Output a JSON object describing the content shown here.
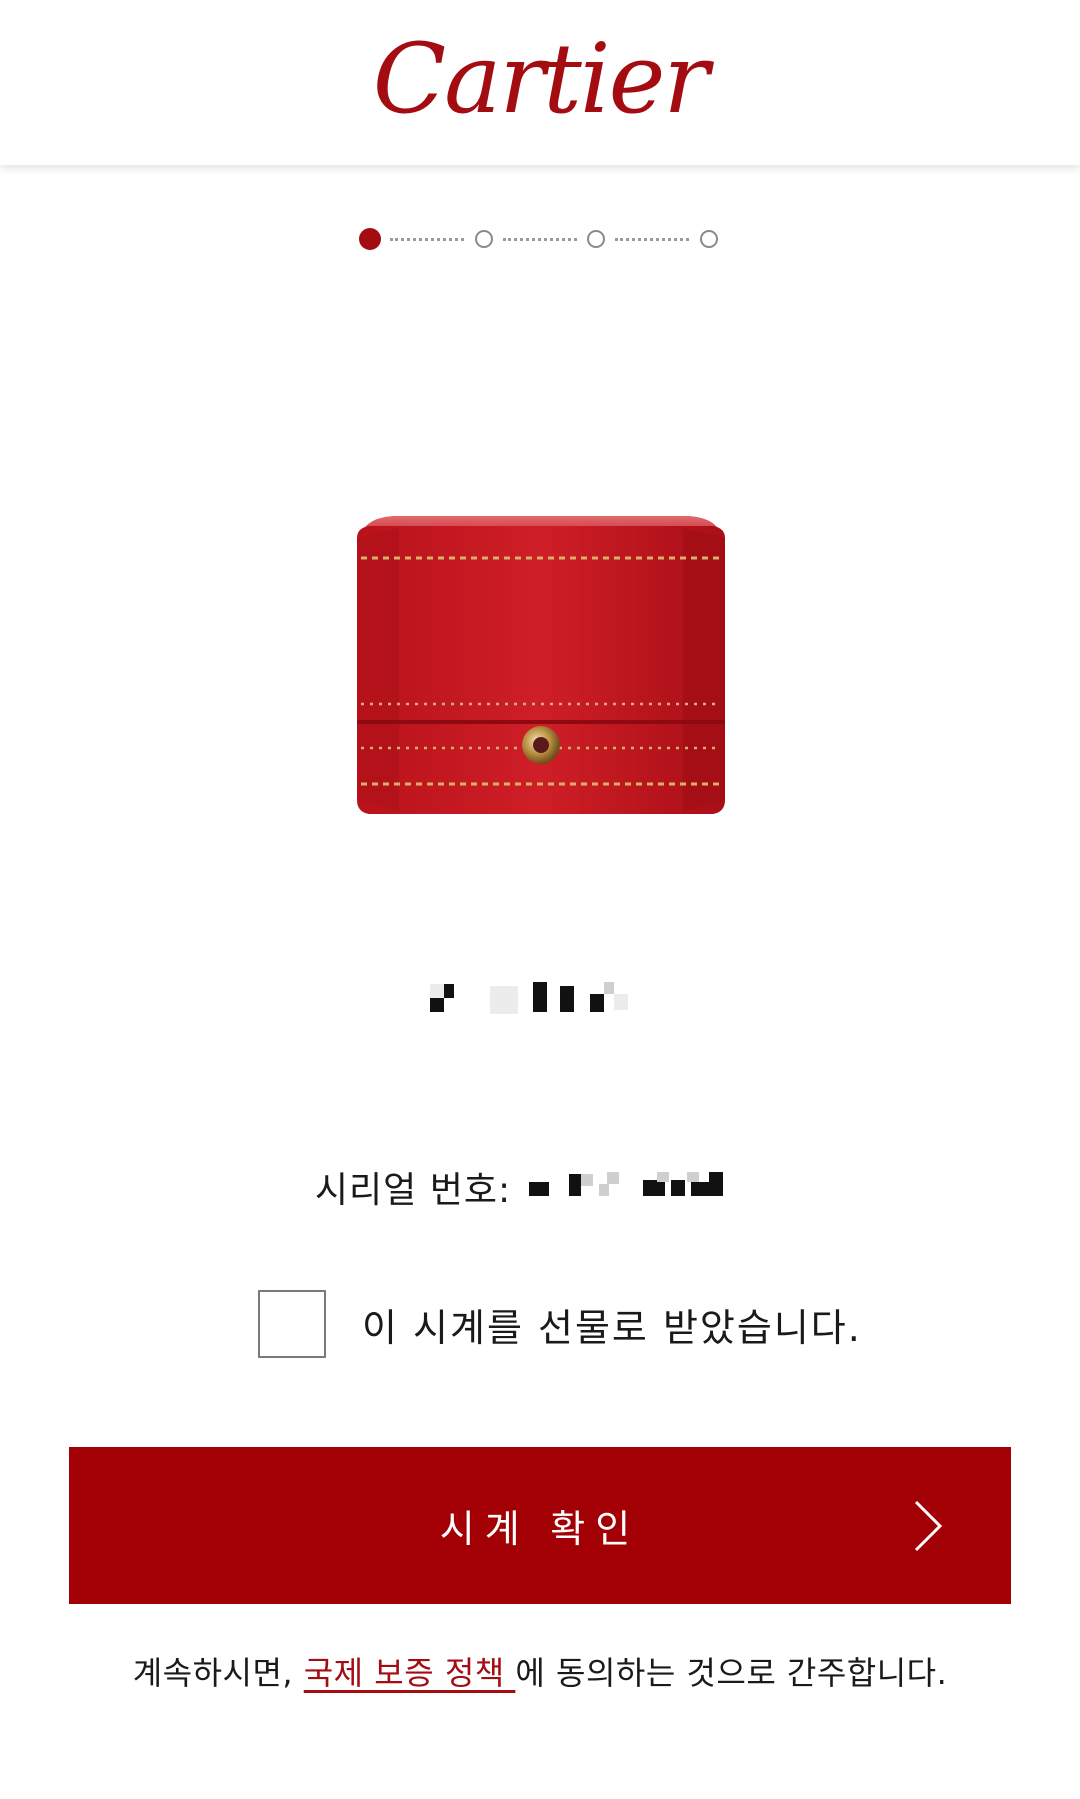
{
  "brand": {
    "logo_text": "Cartier",
    "color": "#a30d12"
  },
  "stepper": {
    "total": 4,
    "current": 1,
    "active_color": "#a30d12"
  },
  "product": {
    "image_name": "red-jewelry-box"
  },
  "serial": {
    "label": "시리얼 번호:"
  },
  "gift": {
    "label": "이 시계를 선물로 받았습니다.",
    "checked": false
  },
  "confirm": {
    "label": "시계 확인",
    "bg_color": "#a30006"
  },
  "terms": {
    "prefix": "계속하시면, ",
    "link": "국제 보증 정책 ",
    "suffix": "에 동의하는 것으로 간주합니다.",
    "link_color": "#a30d12"
  }
}
